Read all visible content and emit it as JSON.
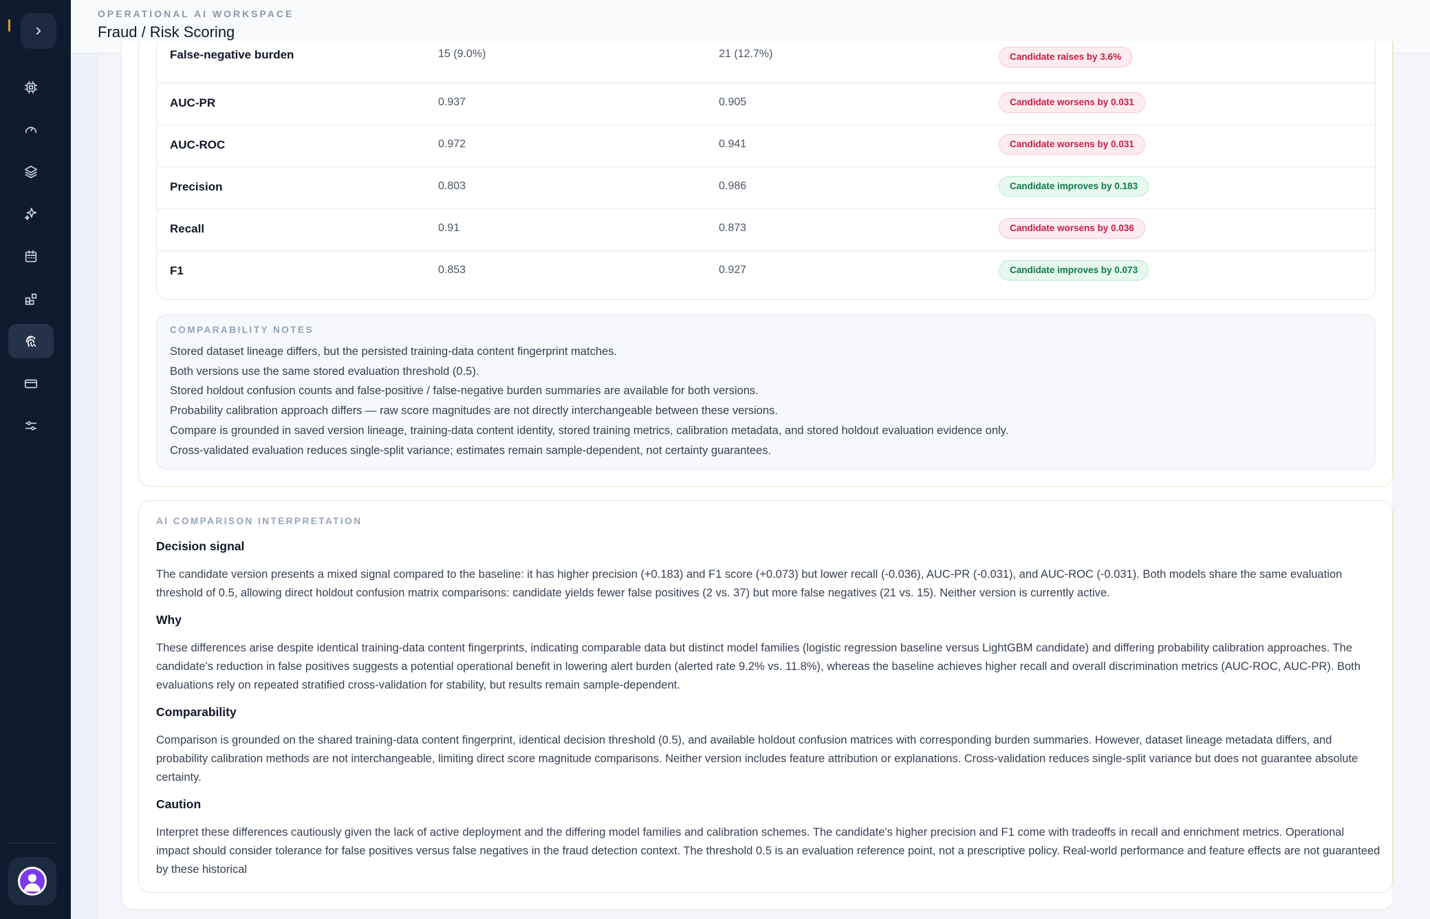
{
  "header": {
    "eyebrow": "OPERATIONAL AI WORKSPACE",
    "title": "Fraud / Risk Scoring"
  },
  "sidebar": {
    "items": [
      {
        "icon": "cpu-icon"
      },
      {
        "icon": "gauge-icon"
      },
      {
        "icon": "layers-icon"
      },
      {
        "icon": "sparkles-icon"
      },
      {
        "icon": "calendar-icon"
      },
      {
        "icon": "blocks-icon"
      },
      {
        "icon": "fingerprint-icon",
        "active": true
      },
      {
        "icon": "card-icon"
      },
      {
        "icon": "sliders-icon"
      }
    ]
  },
  "metrics": [
    {
      "name": "False-negative burden",
      "baseline": "15 (9.0%)",
      "candidate": "21 (12.7%)",
      "delta": "Candidate raises by 3.6%",
      "tone": "worse"
    },
    {
      "name": "AUC-PR",
      "baseline": "0.937",
      "candidate": "0.905",
      "delta": "Candidate worsens by 0.031",
      "tone": "worse"
    },
    {
      "name": "AUC-ROC",
      "baseline": "0.972",
      "candidate": "0.941",
      "delta": "Candidate worsens by 0.031",
      "tone": "worse"
    },
    {
      "name": "Precision",
      "baseline": "0.803",
      "candidate": "0.986",
      "delta": "Candidate improves by 0.183",
      "tone": "better"
    },
    {
      "name": "Recall",
      "baseline": "0.91",
      "candidate": "0.873",
      "delta": "Candidate worsens by 0.036",
      "tone": "worse"
    },
    {
      "name": "F1",
      "baseline": "0.853",
      "candidate": "0.927",
      "delta": "Candidate improves by 0.073",
      "tone": "better"
    }
  ],
  "notes": {
    "title": "COMPARABILITY NOTES",
    "lines": [
      "Stored dataset lineage differs, but the persisted training-data content fingerprint matches.",
      "Both versions use the same stored evaluation threshold (0.5).",
      "Stored holdout confusion counts and false-positive / false-negative burden summaries are available for both versions.",
      "Probability calibration approach differs — raw score magnitudes are not directly interchangeable between these versions.",
      "Compare is grounded in saved version lineage, training-data content identity, stored training metrics, calibration metadata, and stored holdout evaluation evidence only.",
      "Cross-validated evaluation reduces single-split variance; estimates remain sample-dependent, not certainty guarantees."
    ]
  },
  "ai": {
    "title": "AI COMPARISON INTERPRETATION",
    "sections": [
      {
        "heading": "Decision signal",
        "body": "The candidate version presents a mixed signal compared to the baseline: it has higher precision (+0.183) and F1 score (+0.073) but lower recall (-0.036), AUC-PR (-0.031), and AUC-ROC (-0.031). Both models share the same evaluation threshold of 0.5, allowing direct holdout confusion matrix comparisons: candidate yields fewer false positives (2 vs. 37) but more false negatives (21 vs. 15). Neither version is currently active."
      },
      {
        "heading": "Why",
        "body": "These differences arise despite identical training-data content fingerprints, indicating comparable data but distinct model families (logistic regression baseline versus LightGBM candidate) and differing probability calibration approaches. The candidate's reduction in false positives suggests a potential operational benefit in lowering alert burden (alerted rate 9.2% vs. 11.8%), whereas the baseline achieves higher recall and overall discrimination metrics (AUC-ROC, AUC-PR). Both evaluations rely on repeated stratified cross-validation for stability, but results remain sample-dependent."
      },
      {
        "heading": "Comparability",
        "body": "Comparison is grounded on the shared training-data content fingerprint, identical decision threshold (0.5), and available holdout confusion matrices with corresponding burden summaries. However, dataset lineage metadata differs, and probability calibration methods are not interchangeable, limiting direct score magnitude comparisons. Neither version includes feature attribution or explanations. Cross-validation reduces single-split variance but does not guarantee absolute certainty."
      },
      {
        "heading": "Caution",
        "body": "Interpret these differences cautiously given the lack of active deployment and the differing model families and calibration schemes. The candidate's higher precision and F1 come with tradeoffs in recall and enrichment metrics. Operational impact should consider tolerance for false positives versus false negatives in the fraud detection context. The threshold 0.5 is an evaluation reference point, not a prescriptive policy. Real-world performance and feature effects are not guaranteed by these historical"
      }
    ]
  }
}
